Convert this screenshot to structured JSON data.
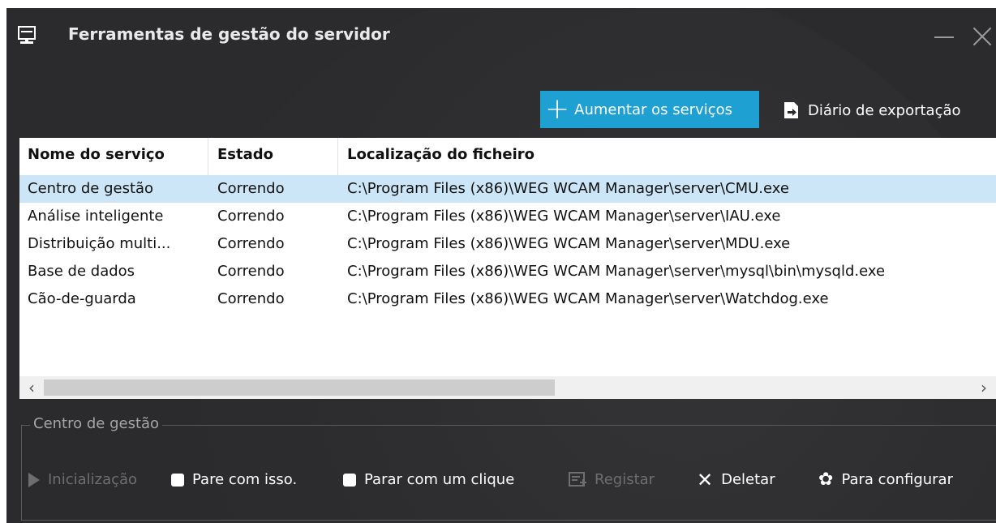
{
  "window": {
    "title": "Ferramentas de gestão do servidor"
  },
  "toolbar": {
    "add_label": "Aumentar os serviços",
    "export_label": "Diário de exportação"
  },
  "table": {
    "headers": [
      "Nome do serviço",
      "Estado",
      "Localização do ficheiro"
    ],
    "rows": [
      {
        "name": "Centro de gestão",
        "status": "Correndo",
        "path": "C:\\Program Files (x86)\\WEG WCAM Manager\\server\\CMU.exe"
      },
      {
        "name": "Análise inteligente",
        "status": "Correndo",
        "path": "C:\\Program Files (x86)\\WEG WCAM Manager\\server\\IAU.exe"
      },
      {
        "name": "Distribuição multi...",
        "status": "Correndo",
        "path": "C:\\Program Files (x86)\\WEG WCAM Manager\\server\\MDU.exe"
      },
      {
        "name": "Base de dados",
        "status": "Correndo",
        "path": "C:\\Program Files (x86)\\WEG WCAM Manager\\server\\mysql\\bin\\mysqld.exe"
      },
      {
        "name": "Cão-de-guarda",
        "status": "Correndo",
        "path": "C:\\Program Files (x86)\\WEG WCAM Manager\\server\\Watchdog.exe"
      }
    ],
    "selected_row": 0
  },
  "panel": {
    "title": "Centro de gestão",
    "actions": {
      "start": "Inicialização",
      "stop": "Pare com isso.",
      "stop_one_click": "Parar com um clique",
      "register": "Registar",
      "delete": "Deletar",
      "configure": "Para configurar"
    }
  },
  "colors": {
    "accent": "#1ea0d2",
    "background": "#2b2b2d",
    "selected_row": "#cce6f7"
  },
  "icons": [
    "server-icon",
    "minimize-icon",
    "close-icon",
    "plus-icon",
    "export-icon",
    "play-icon",
    "stop-icon",
    "register-icon",
    "delete-icon",
    "gear-icon"
  ]
}
